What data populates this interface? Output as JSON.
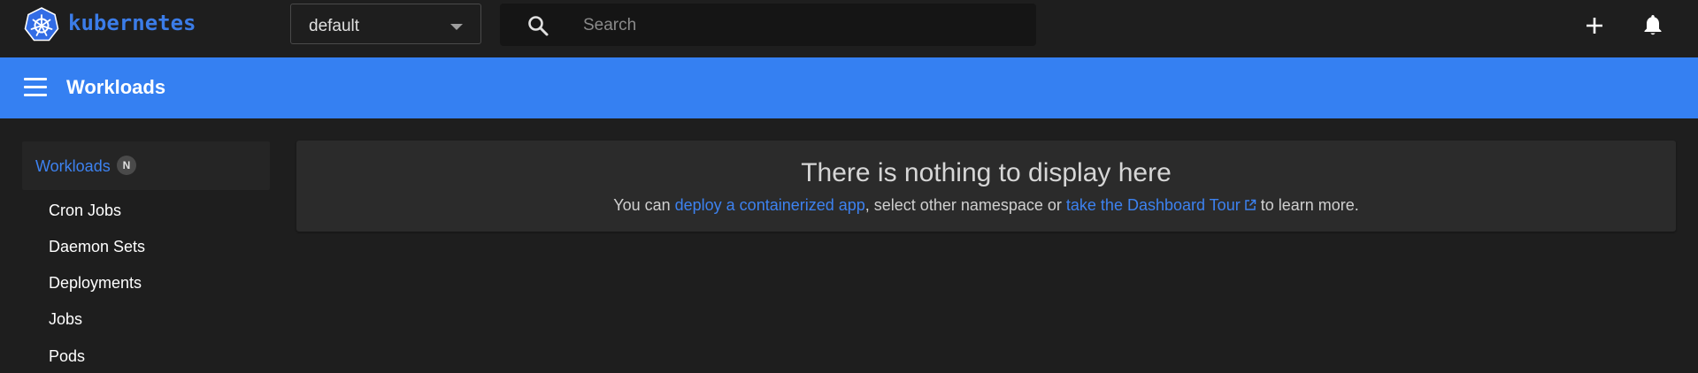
{
  "topbar": {
    "brand": "kubernetes",
    "namespace": "default",
    "search_placeholder": "Search"
  },
  "header": {
    "title": "Workloads"
  },
  "sidebar": {
    "active": {
      "label": "Workloads",
      "badge": "N"
    },
    "items": [
      {
        "label": "Cron Jobs"
      },
      {
        "label": "Daemon Sets"
      },
      {
        "label": "Deployments"
      },
      {
        "label": "Jobs"
      },
      {
        "label": "Pods"
      }
    ]
  },
  "empty_state": {
    "title": "There is nothing to display here",
    "prefix": "You can ",
    "link1": "deploy a containerized app",
    "middle": ", select other namespace or ",
    "link2": "take the Dashboard Tour",
    "suffix": " to learn more."
  },
  "icons": {
    "logo": "kubernetes-logo-icon",
    "search": "search-icon",
    "add": "plus-icon",
    "notifications": "bell-icon",
    "menu": "hamburger-menu-icon",
    "external": "open-in-new-icon"
  },
  "colors": {
    "accent": "#3580f2",
    "link": "#3d82f0",
    "background": "#1e1e1e",
    "card": "#2b2b2b"
  }
}
